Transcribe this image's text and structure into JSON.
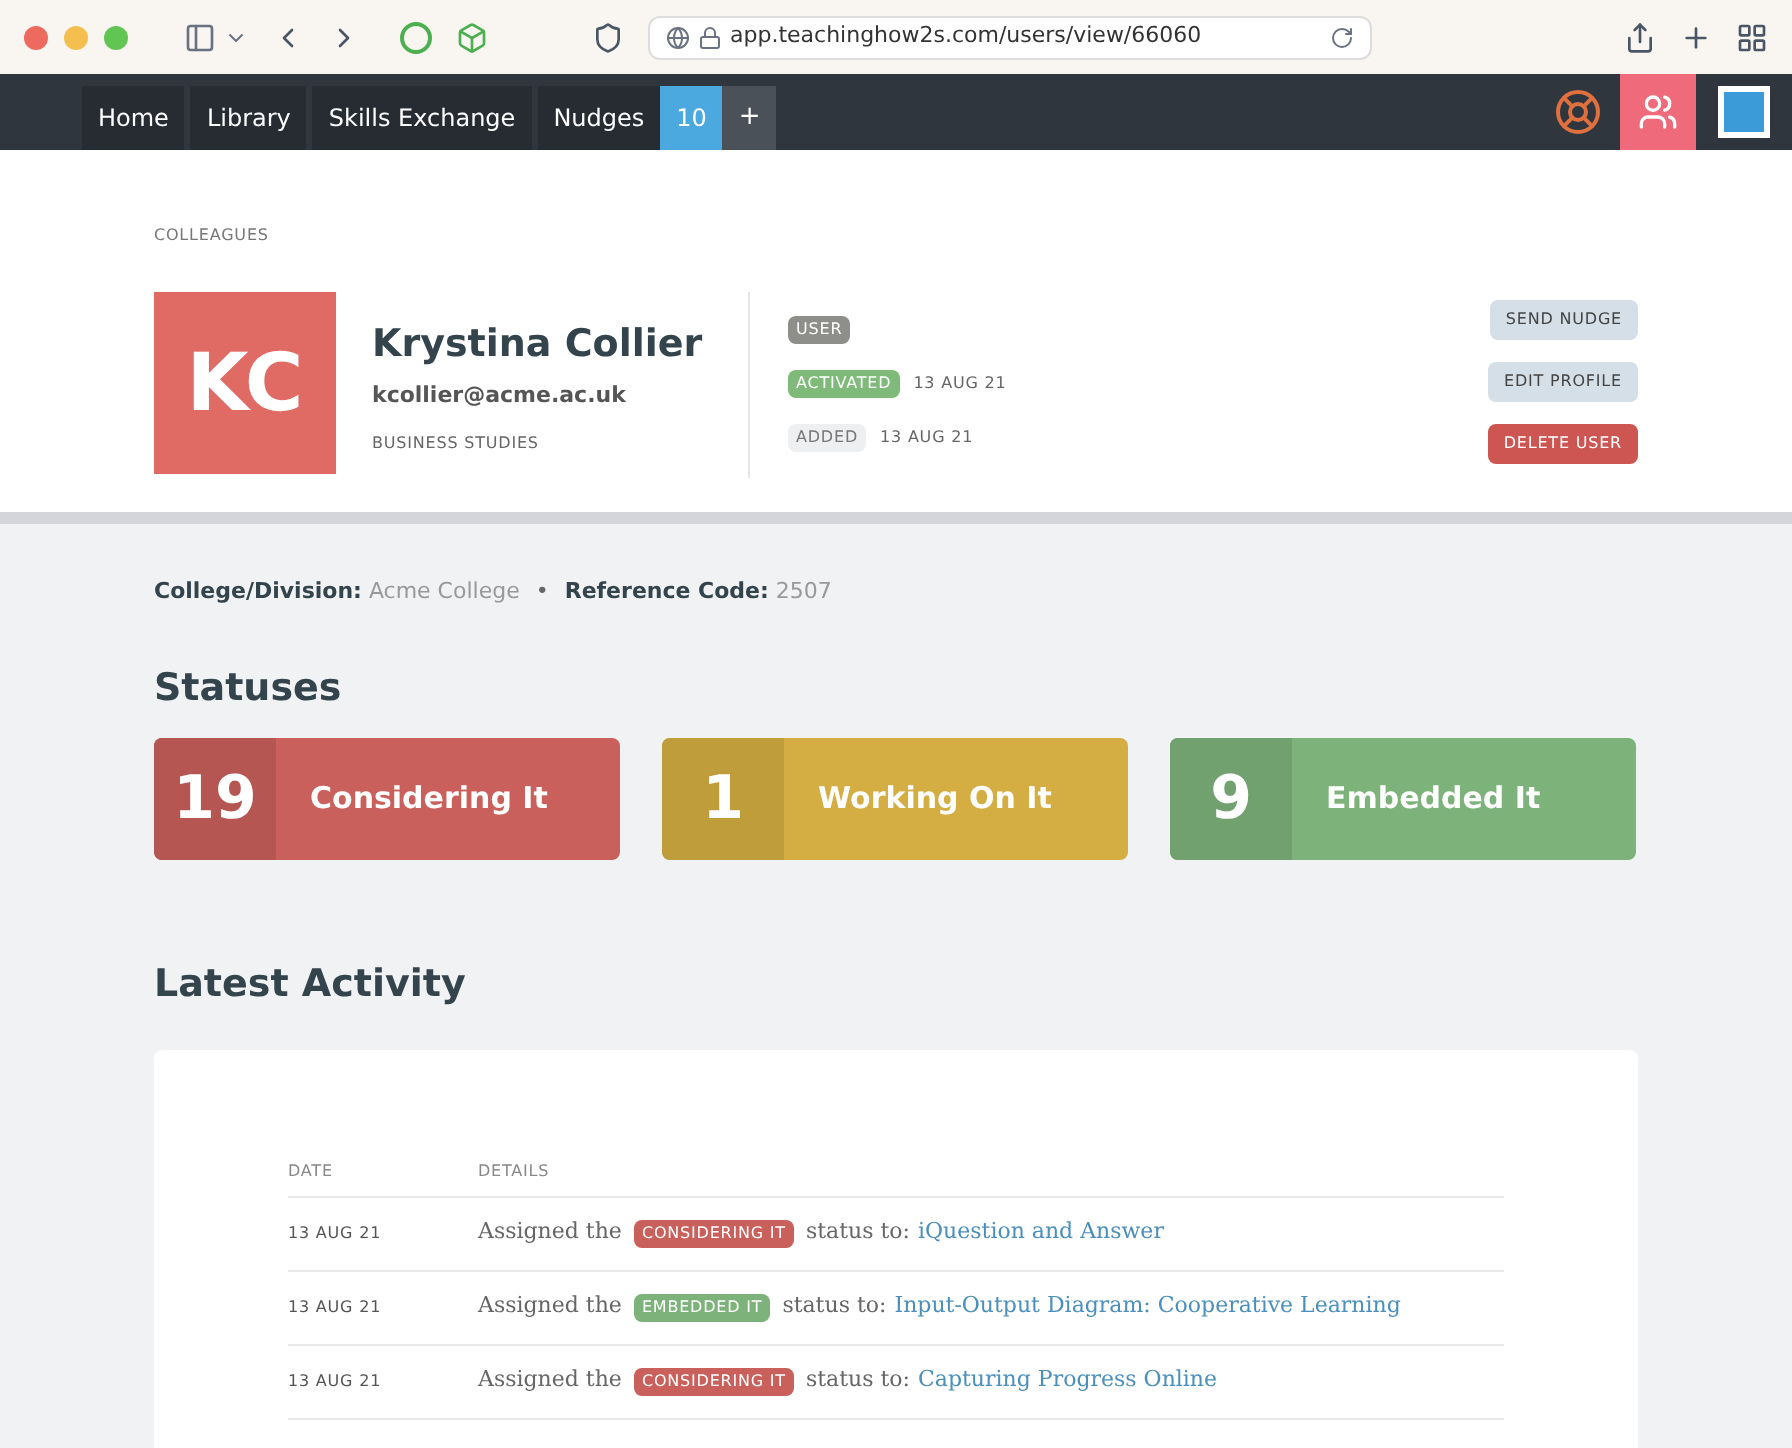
{
  "browser": {
    "url": "app.teachinghow2s.com/users/view/66060"
  },
  "nav": {
    "items": [
      "Home",
      "Library",
      "Skills Exchange",
      "Nudges"
    ],
    "count": "10",
    "add": "+"
  },
  "breadcrumb": "COLLEAGUES",
  "profile": {
    "initials": "KC",
    "name": "Krystina Collier",
    "email": "kcollier@acme.ac.uk",
    "department": "BUSINESS STUDIES",
    "tags": [
      {
        "label": "USER",
        "color": "#8e8e8a"
      },
      {
        "label": "ACTIVATED",
        "color": "#7fba7a",
        "date": "13 AUG 21"
      },
      {
        "label": "ADDED",
        "color": "#eeeff1",
        "date": "13 AUG 21"
      }
    ],
    "actions": [
      {
        "label": "SEND NUDGE",
        "kind": "neutral"
      },
      {
        "label": "EDIT PROFILE",
        "kind": "neutral"
      },
      {
        "label": "DELETE USER",
        "kind": "danger"
      }
    ]
  },
  "meta": [
    {
      "label": "College/Division:",
      "value": "Acme College"
    },
    {
      "label": "Reference Code:",
      "value": "2507"
    }
  ],
  "separator": "•",
  "statuses_title": "Statuses",
  "statuses": [
    {
      "count": "19",
      "label": "Considering It",
      "color": "#c9605b"
    },
    {
      "count": "1",
      "label": "Working On It",
      "color": "#d4ae42"
    },
    {
      "count": "9",
      "label": "Embedded It",
      "color": "#7db37a"
    }
  ],
  "activity_title": "Latest Activity",
  "activity": {
    "columns": [
      "DATE",
      "DETAILS"
    ],
    "rows": [
      {
        "date": "13 AUG 21",
        "prefix": "Assigned the",
        "badge": "CONSIDERING IT",
        "color": "#c9605b",
        "middle": "status to:",
        "link": "iQuestion and Answer"
      },
      {
        "date": "13 AUG 21",
        "prefix": "Assigned the",
        "badge": "EMBEDDED IT",
        "color": "#7db37a",
        "middle": "status to:",
        "link": "Input-Output Diagram: Cooperative Learning"
      },
      {
        "date": "13 AUG 21",
        "prefix": "Assigned the",
        "badge": "CONSIDERING IT",
        "color": "#c9605b",
        "middle": "status to:",
        "link": "Capturing Progress Online"
      }
    ]
  }
}
